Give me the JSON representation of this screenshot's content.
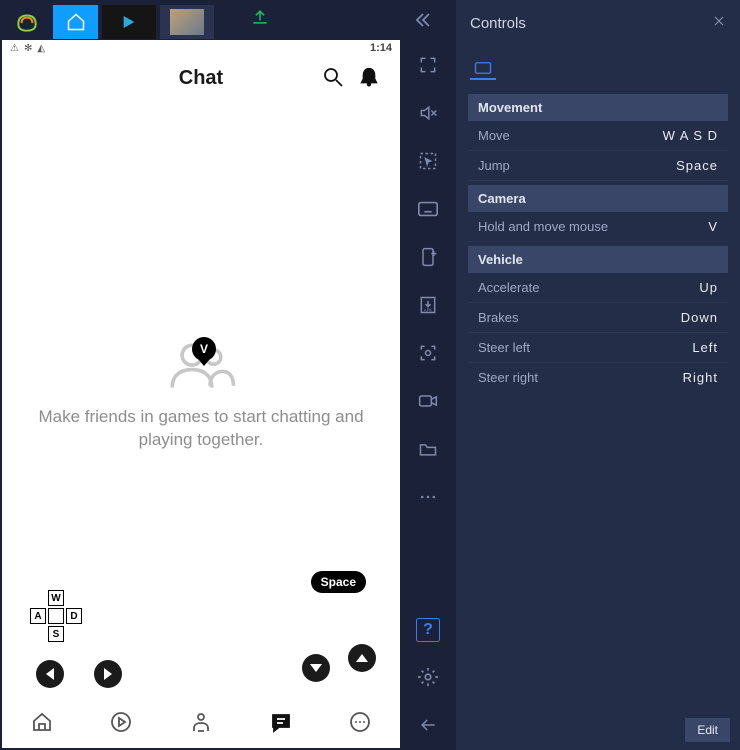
{
  "status_bar": {
    "time": "1:14"
  },
  "app": {
    "title": "Chat",
    "empty_message": "Make friends in games to start chatting and playing together."
  },
  "overlays": {
    "wasd": {
      "w": "W",
      "a": "A",
      "s": "S",
      "d": "D"
    },
    "v_key": "V",
    "space_pill": "Space"
  },
  "controls_panel": {
    "title": "Controls",
    "edit_label": "Edit",
    "sections": [
      {
        "name": "Movement",
        "rows": [
          {
            "label": "Move",
            "value": "W A S D"
          },
          {
            "label": "Jump",
            "value": "Space"
          }
        ]
      },
      {
        "name": "Camera",
        "rows": [
          {
            "label": "Hold and move mouse",
            "value": "V"
          }
        ]
      },
      {
        "name": "Vehicle",
        "rows": [
          {
            "label": "Accelerate",
            "value": "Up"
          },
          {
            "label": "Brakes",
            "value": "Down"
          },
          {
            "label": "Steer left",
            "value": "Left"
          },
          {
            "label": "Steer right",
            "value": "Right"
          }
        ]
      }
    ]
  }
}
